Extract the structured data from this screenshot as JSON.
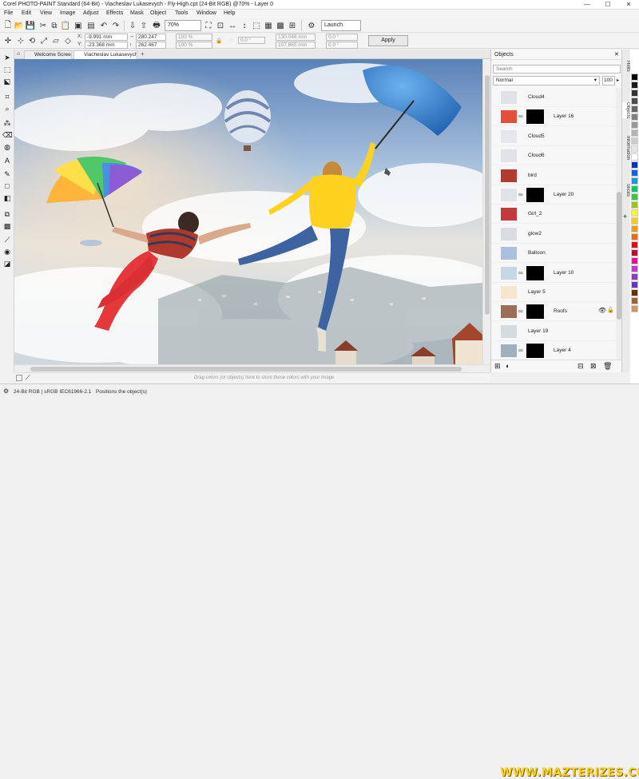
{
  "window": {
    "title": "Corel PHOTO-PAINT Standard (64-Bit) - Viacheslav Lukasevych - Fly-High.cpt (24-Bit RGB) @70% - Layer 0",
    "minimize": "—",
    "maximize": "☐",
    "close": "✕"
  },
  "menu": [
    "File",
    "Edit",
    "View",
    "Image",
    "Adjust",
    "Effects",
    "Mask",
    "Object",
    "Tools",
    "Window",
    "Help"
  ],
  "toolbar": {
    "zoom": "70%",
    "launch": "Launch"
  },
  "propbar": {
    "x_label": "X:",
    "x_value": "-9.991 mm",
    "y_label": "Y:",
    "y_value": "-23.368 mm",
    "width_value": "280.247 mm",
    "height_value": "262.467 mm",
    "scale_w": "100 %",
    "scale_h": "100 %",
    "rotation": "0.0 °",
    "center_x": "130.048 mm",
    "center_y": "107.865 mm",
    "skew_h": "0.0 °",
    "skew_v": "0.0 °",
    "apply": "Apply"
  },
  "tabs": [
    {
      "label": "Welcome Screen"
    },
    {
      "label": "Viacheslav Lukasevych ..."
    }
  ],
  "colorstrip_hint": "Drag colors (or objects) here to store these colors with your image",
  "status": {
    "color_mode": "24-Bit RGB | sRGB IEC61966-2.1",
    "message": "Positions the object(s)"
  },
  "watermark": "WWW.MAZTERIZES.COM",
  "objects_docker": {
    "title": "Objects",
    "search_placeholder": "Search",
    "blend_mode": "Normal",
    "opacity": "100",
    "layers": [
      {
        "name": "Cloud4",
        "mask": false
      },
      {
        "name": "Layer 16",
        "mask": true
      },
      {
        "name": "Cloud5",
        "mask": false
      },
      {
        "name": "Cloud6",
        "mask": false
      },
      {
        "name": "bird",
        "mask": false
      },
      {
        "name": "Layer 20",
        "mask": true
      },
      {
        "name": "Girl_2",
        "mask": false
      },
      {
        "name": "glow2",
        "mask": false
      },
      {
        "name": "Balloon",
        "mask": false
      },
      {
        "name": "Layer 10",
        "mask": true
      },
      {
        "name": "Layer 5",
        "mask": false
      },
      {
        "name": "Roofs",
        "mask": true
      },
      {
        "name": "Layer 19",
        "mask": false
      },
      {
        "name": "Layer 4",
        "mask": true
      }
    ]
  },
  "side_tabs": [
    "Hints",
    "Objects",
    "Information",
    "Slices"
  ],
  "palette_colors": [
    "#000000",
    "#1a1a1a",
    "#333333",
    "#4d4d4d",
    "#666666",
    "#808080",
    "#999999",
    "#b3b3b3",
    "#cccccc",
    "#e6e6e6",
    "#ffffff",
    "#0033cc",
    "#0066ff",
    "#00a0e9",
    "#00cc66",
    "#33cc33",
    "#99cc00",
    "#ffff00",
    "#ffcc00",
    "#ff9900",
    "#ff6600",
    "#ff0000",
    "#cc0033",
    "#ff0099",
    "#cc33cc",
    "#9933cc",
    "#6633cc",
    "#663300",
    "#996633",
    "#cc9966"
  ]
}
